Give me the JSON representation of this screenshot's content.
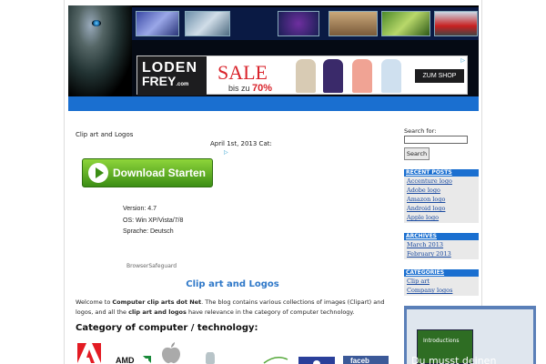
{
  "ad": {
    "brand_line1": "LODEN",
    "brand_line2": "FREY",
    "brand_suffix": ".com",
    "sale": "SALE",
    "sale_prefix": "bis zu",
    "sale_percent": "70%",
    "shop_button": "ZUM SHOP",
    "garment_colors": [
      "#d8cbb4",
      "#3a2a6a",
      "#f0a394",
      "#cfe0ef"
    ]
  },
  "post": {
    "title": "Clip art and Logos",
    "meta": "April 1st, 2013 Cat:",
    "download_button": "Download Starten",
    "specs": [
      "Version: 4.7",
      "OS: Win XP/Vista/7/8",
      "Sprache: Deutsch"
    ],
    "safeguard": "BrowserSafeguard",
    "heading": "Clip art and Logos",
    "intro_parts": [
      "Welcome to ",
      "Computer clip arts dot Net",
      ". The blog contains various collections of images (Clipart) and logos, and all the ",
      "clip art and logos",
      " have relevance in the category of computer technology."
    ],
    "category_heading": "Category of computer / technology:",
    "logos": [
      "adobe-logo",
      "amd-logo",
      "apple-logo",
      "android-logo",
      "acer-logo",
      "facebook-logo"
    ]
  },
  "sidebar": {
    "search_label": "Search for:",
    "search_value": "",
    "search_button": "Search",
    "recent_posts": {
      "title": "RECENT POSTS",
      "items": [
        "Accenture logo",
        "Adobe logo",
        "Amazon logo",
        "Android logo",
        "Apple logo"
      ]
    },
    "archives": {
      "title": "ARCHIVES",
      "items": [
        "March 2013",
        "February 2013"
      ]
    },
    "categories": {
      "title": "CATEGORIES",
      "items": [
        "Clip art",
        "Company logos"
      ]
    },
    "video": {
      "slide_label": "Introductions",
      "caption": "Du musst deinen"
    }
  },
  "colors": {
    "accent_blue": "#1a6fd0",
    "heading_blue": "#2f78c8",
    "sale_red": "#d9232b",
    "download_green": "#3c8e15"
  }
}
